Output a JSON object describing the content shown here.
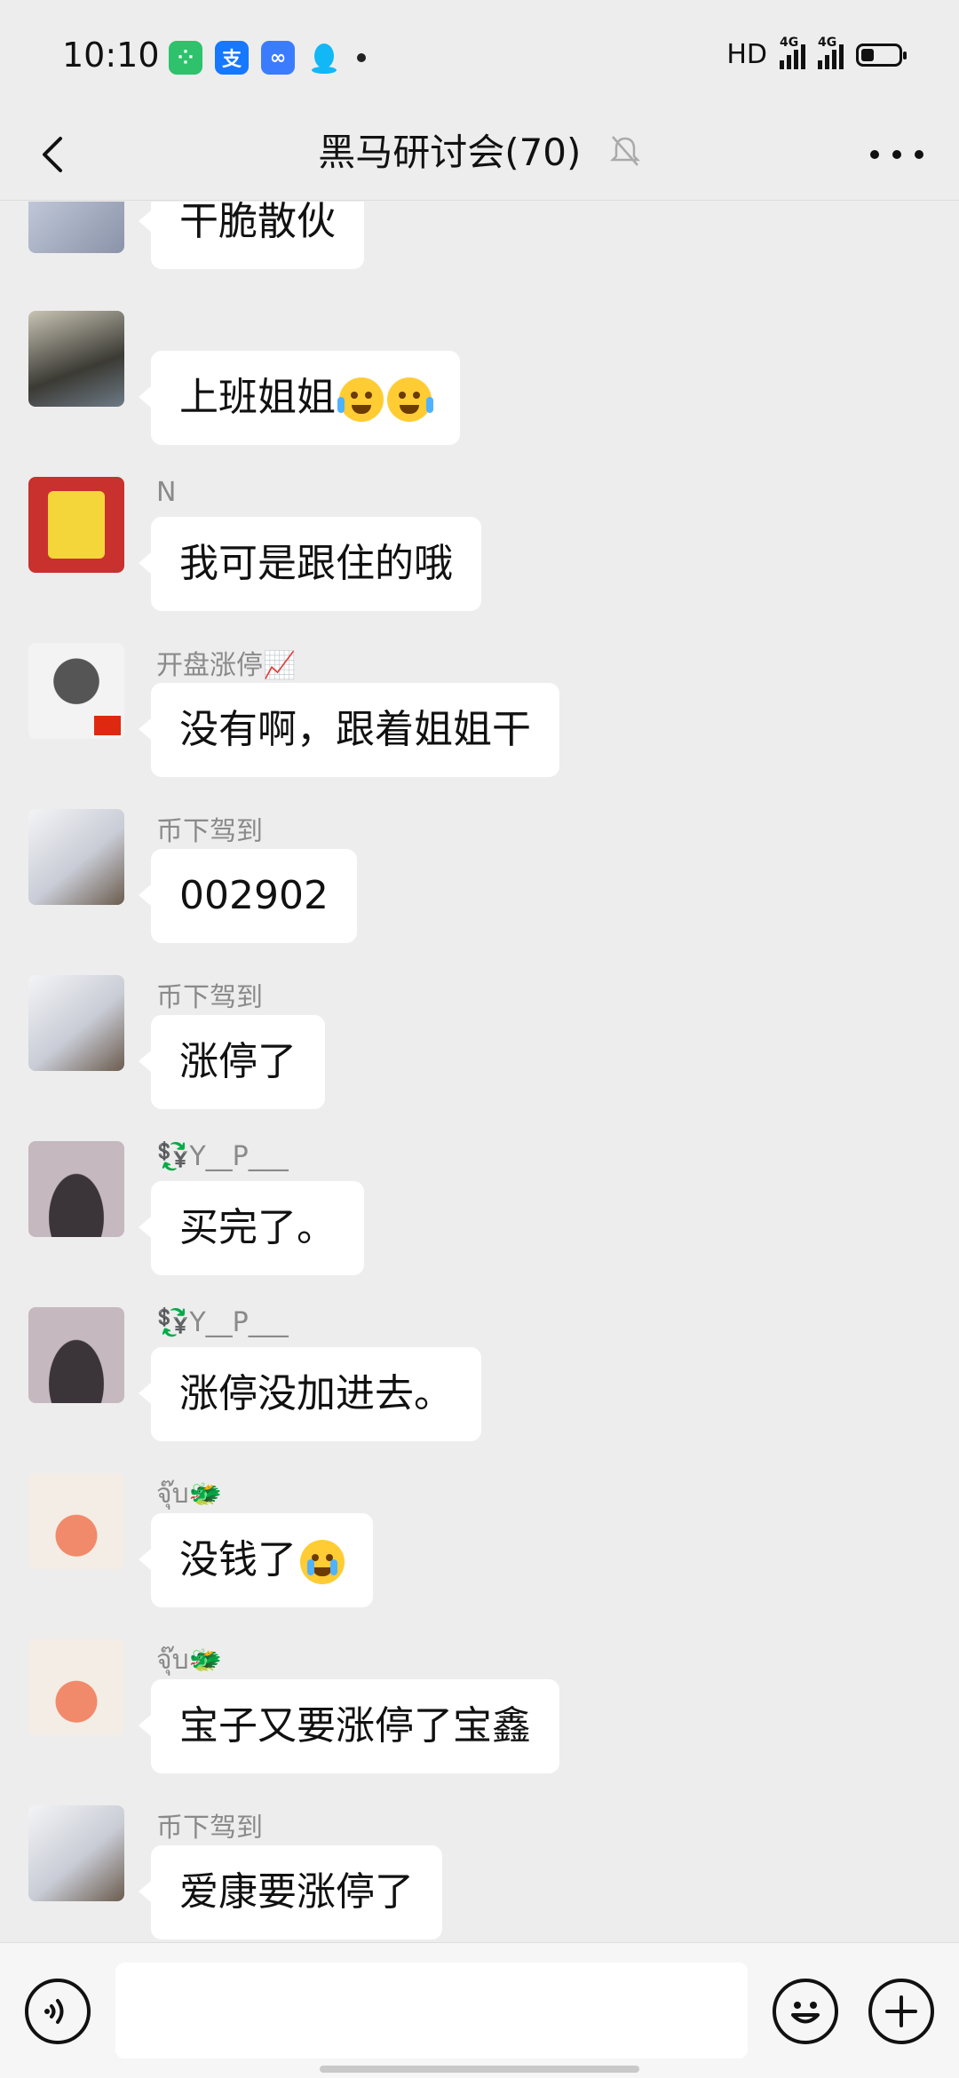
{
  "status": {
    "time": "10:10",
    "network_label": "HD",
    "signal1_label": "4G",
    "signal2_label": "4G",
    "battery_percent": 36
  },
  "header": {
    "title": "黑马研讨会(70)"
  },
  "messages": [
    {
      "sender": "",
      "text": "干脆散伙"
    },
    {
      "sender": "",
      "text": "上班姐姐"
    },
    {
      "sender": "N",
      "text": "我可是跟住的哦"
    },
    {
      "sender": "开盘涨停📈",
      "text": "没有啊，跟着姐姐干"
    },
    {
      "sender": "币下驾到",
      "text": "002902"
    },
    {
      "sender": "币下驾到",
      "text": "涨停了"
    },
    {
      "sender": "💱Y__P___",
      "text": "买完了。"
    },
    {
      "sender": "💱Y__P___",
      "text": "涨停没加进去。"
    },
    {
      "sender": "จุ๊บ🐲",
      "text": "没钱了"
    },
    {
      "sender": "จุ๊บ🐲",
      "text": "宝子又要涨停了宝鑫"
    },
    {
      "sender": "币下驾到",
      "text": "爱康要涨停了"
    }
  ],
  "input": {
    "placeholder": ""
  }
}
